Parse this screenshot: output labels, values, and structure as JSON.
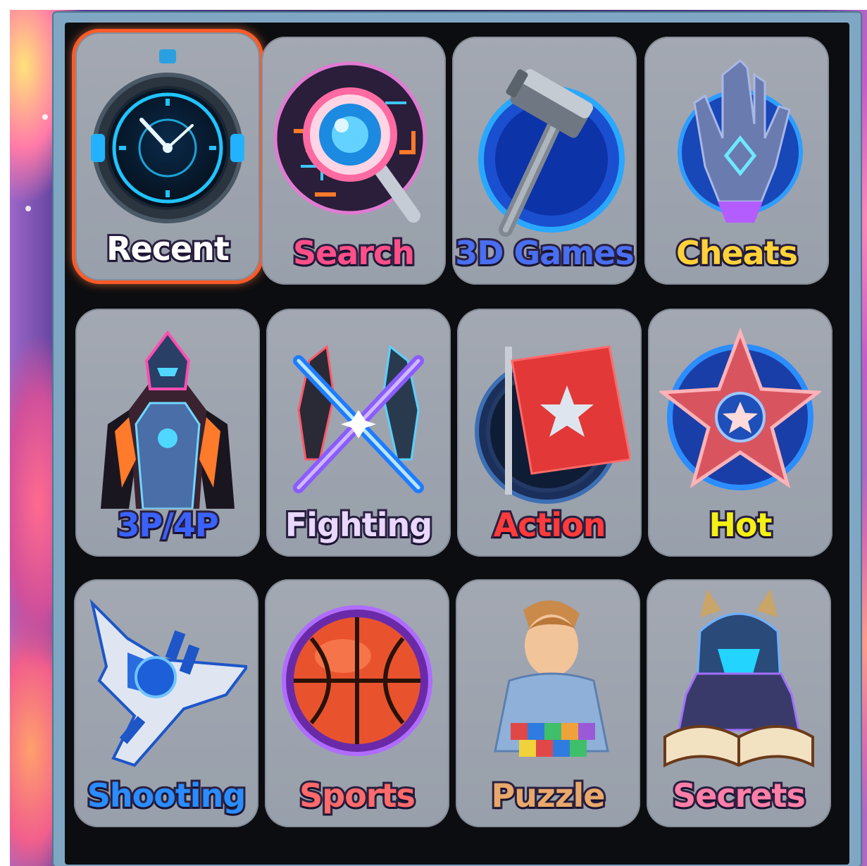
{
  "menu": {
    "selected_index": 0,
    "tiles": [
      {
        "label": "Recent",
        "icon": "clock-icon",
        "color": "#ffffff"
      },
      {
        "label": "Search",
        "icon": "magnifier-icon",
        "color": "#ff4f8a"
      },
      {
        "label": "3D Games",
        "icon": "hammer-icon",
        "color": "#4a6ef0"
      },
      {
        "label": "Cheats",
        "icon": "hand-icon",
        "color": "#ffd23a"
      },
      {
        "label": "3P/4P",
        "icon": "robot-squad-icon",
        "color": "#3b62ff"
      },
      {
        "label": "Fighting",
        "icon": "crossed-swords-icon",
        "color": "#e9d8ff"
      },
      {
        "label": "Action",
        "icon": "flag-icon",
        "color": "#ff3b3b"
      },
      {
        "label": "Hot",
        "icon": "star-icon",
        "color": "#f4f016"
      },
      {
        "label": "Shooting",
        "icon": "fighter-jet-icon",
        "color": "#2a8cff"
      },
      {
        "label": "Sports",
        "icon": "basketball-icon",
        "color": "#ff6a6a"
      },
      {
        "label": "Puzzle",
        "icon": "hero-with-blocks-icon",
        "color": "#e8a86c"
      },
      {
        "label": "Secrets",
        "icon": "knight-book-icon",
        "color": "#ff7fa8"
      }
    ]
  }
}
